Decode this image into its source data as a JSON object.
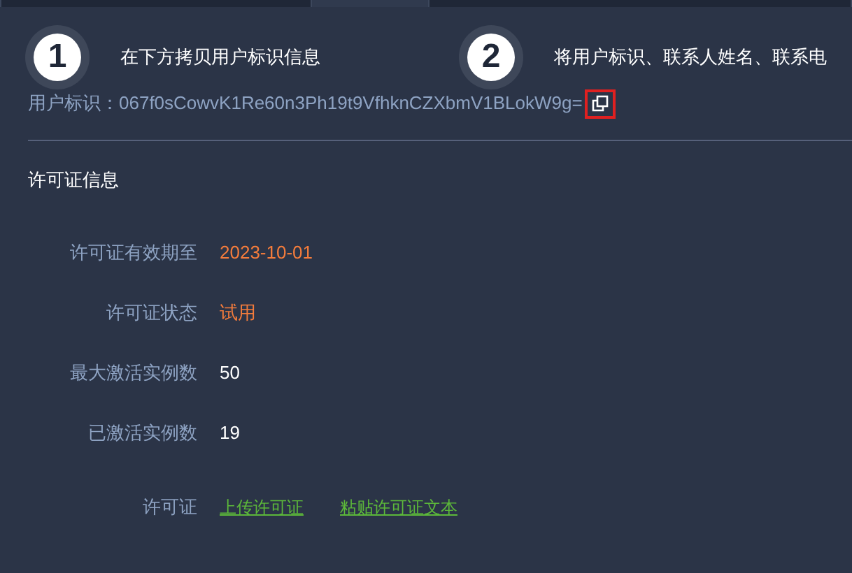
{
  "tabs": [
    {
      "selected": false
    },
    {
      "selected": true
    },
    {
      "selected": false
    }
  ],
  "steps": [
    {
      "number": "1",
      "text": "在下方拷贝用户标识信息"
    },
    {
      "number": "2",
      "text": "将用户标识、联系人姓名、联系电"
    }
  ],
  "user_id": {
    "label": "用户标识：",
    "value": "067f0sCowvK1Re60n3Ph19t9VfhknCZXbmV1BLokW9g="
  },
  "section_title": "许可证信息",
  "fields": [
    {
      "kind": "text",
      "label": "许可证有效期至",
      "value": "2023-10-01",
      "color": "#f47c3c"
    },
    {
      "kind": "text",
      "label": "许可证状态",
      "value": "试用",
      "color": "#f47c3c"
    },
    {
      "kind": "text",
      "label": "最大激活实例数",
      "value": "50",
      "color": "#ffffff"
    },
    {
      "kind": "text",
      "label": "已激活实例数",
      "value": "19",
      "color": "#ffffff"
    },
    {
      "kind": "links",
      "label": "许可证",
      "links": [
        "上传许可证",
        "粘贴许可证文本"
      ]
    }
  ]
}
